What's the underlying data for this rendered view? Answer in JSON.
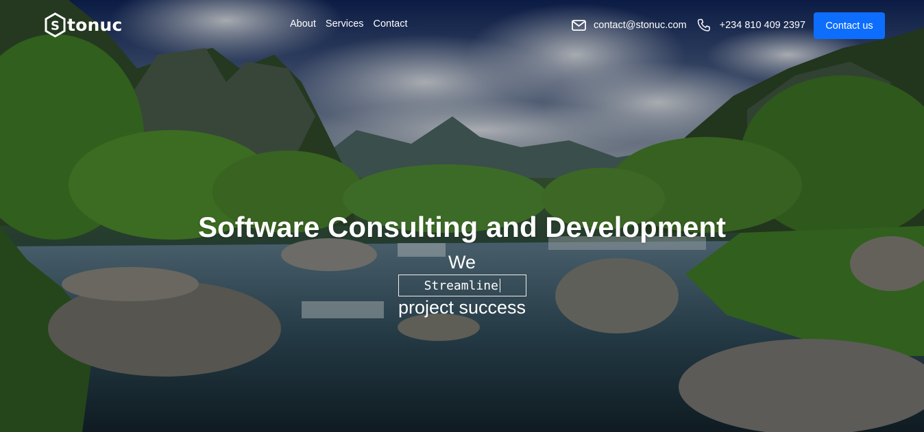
{
  "brand": {
    "name": "tonuc",
    "logo_letter": "S"
  },
  "nav": {
    "items": [
      {
        "label": "About"
      },
      {
        "label": "Services"
      },
      {
        "label": "Contact"
      }
    ]
  },
  "contact": {
    "email": "contact@stonuc.com",
    "phone": "+234 810 409 2397",
    "email_icon": "envelope-icon",
    "phone_icon": "phone-icon"
  },
  "cta": {
    "label": "Contact us",
    "color": "#0d6efd"
  },
  "hero": {
    "headline": "Software Consulting and Development",
    "lead": "We",
    "typed_word": "Streamline",
    "tail": "project success"
  }
}
